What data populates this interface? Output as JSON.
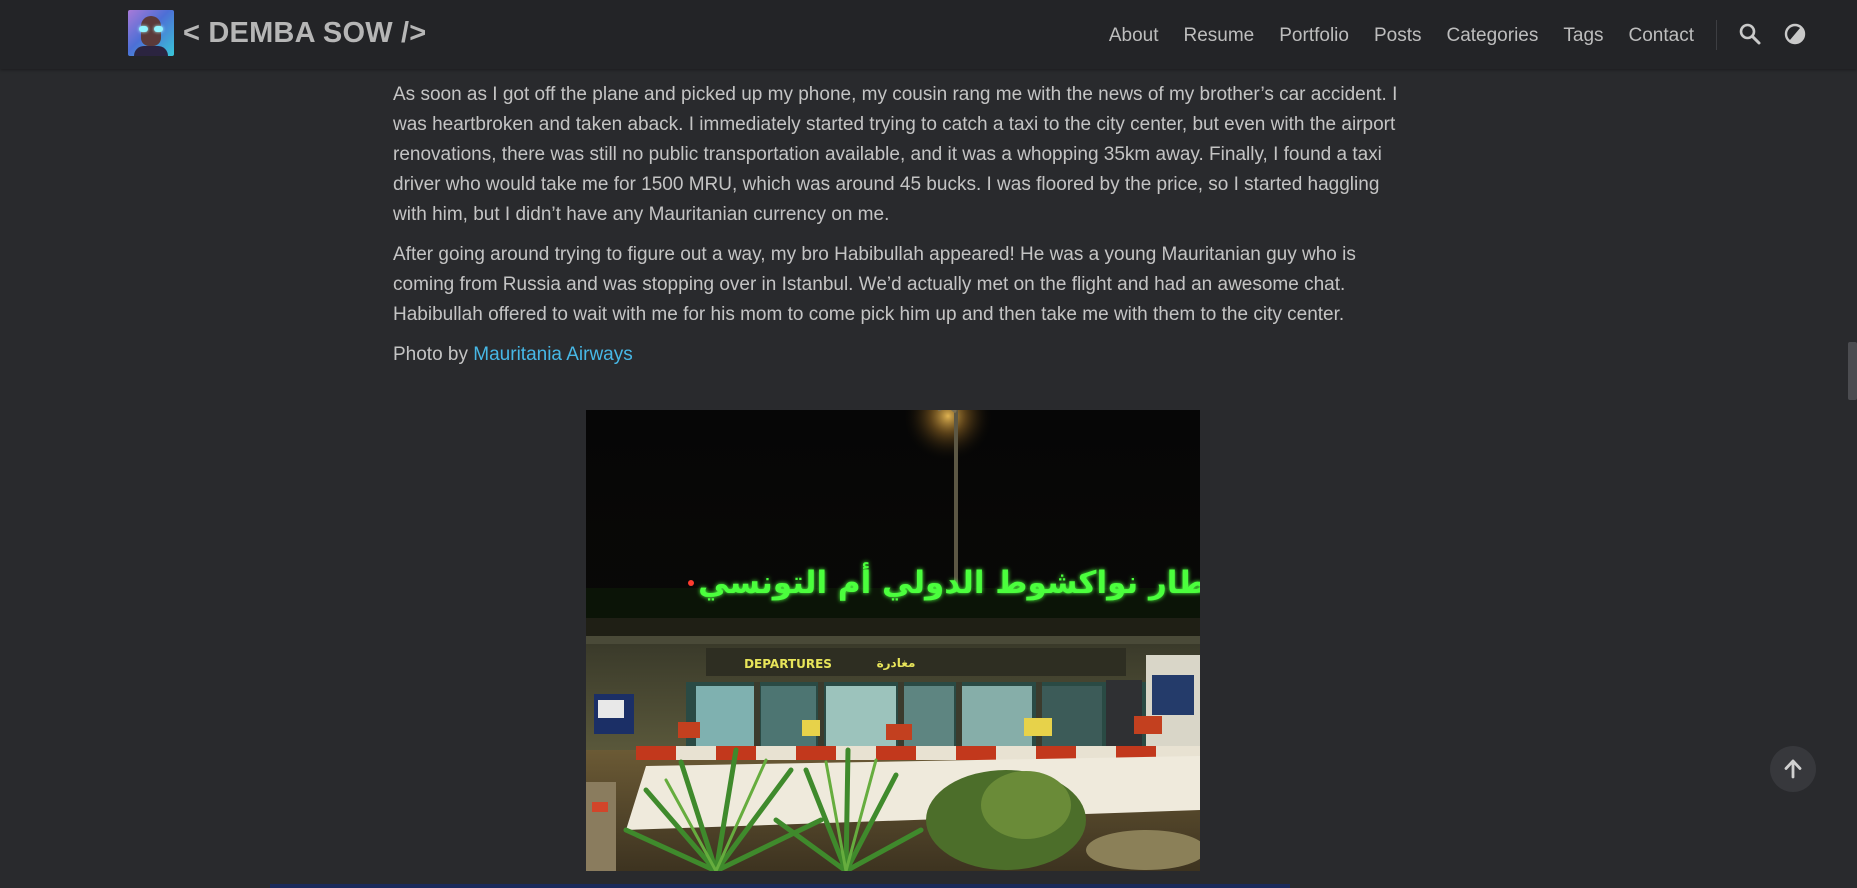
{
  "header": {
    "brand": "< DEMBA SOW />",
    "nav": [
      {
        "label": "About"
      },
      {
        "label": "Resume"
      },
      {
        "label": "Portfolio"
      },
      {
        "label": "Posts"
      },
      {
        "label": "Categories"
      },
      {
        "label": "Tags"
      },
      {
        "label": "Contact"
      }
    ],
    "icons": {
      "search": "search-icon",
      "theme": "theme-toggle-icon"
    }
  },
  "article": {
    "paragraphs": [
      "As soon as I got off the plane and picked up my phone, my cousin rang me with the news of my brother’s car accident. I was heartbroken and taken aback. I immediately started trying to catch a taxi to the city center, but even with the airport renovations, there was still no public transportation available, and it was a whopping 35km away. Finally, I found a taxi driver who would take me for 1500 MRU, which was around 45 bucks. I was floored by the price, so I started haggling with him, but I didn’t have any Mauritanian currency on me.",
      "After going around trying to figure out a way, my bro Habibullah appeared! He was a young Mauritanian guy who is coming from Russia and was stopping over in Istanbul. We’d actually met on the flight and had an awesome chat. Habibullah offered to wait with me for his mom to come pick him up and then take me with them to the city center."
    ],
    "photo_credit_prefix": "Photo by ",
    "photo_credit_link": "Mauritania Airways",
    "photo": {
      "sign_text": "مطار نواكشوط الدولي أم التونسي",
      "departures_label": "DEPARTURES",
      "departures_arabic": "مغادرة"
    }
  },
  "colors": {
    "background": "#292a2d",
    "navbar": "#232427",
    "link": "#47b8e6",
    "text": "#c4c4c4"
  },
  "floating": {
    "back_to_top_icon": "arrow-up-icon"
  }
}
